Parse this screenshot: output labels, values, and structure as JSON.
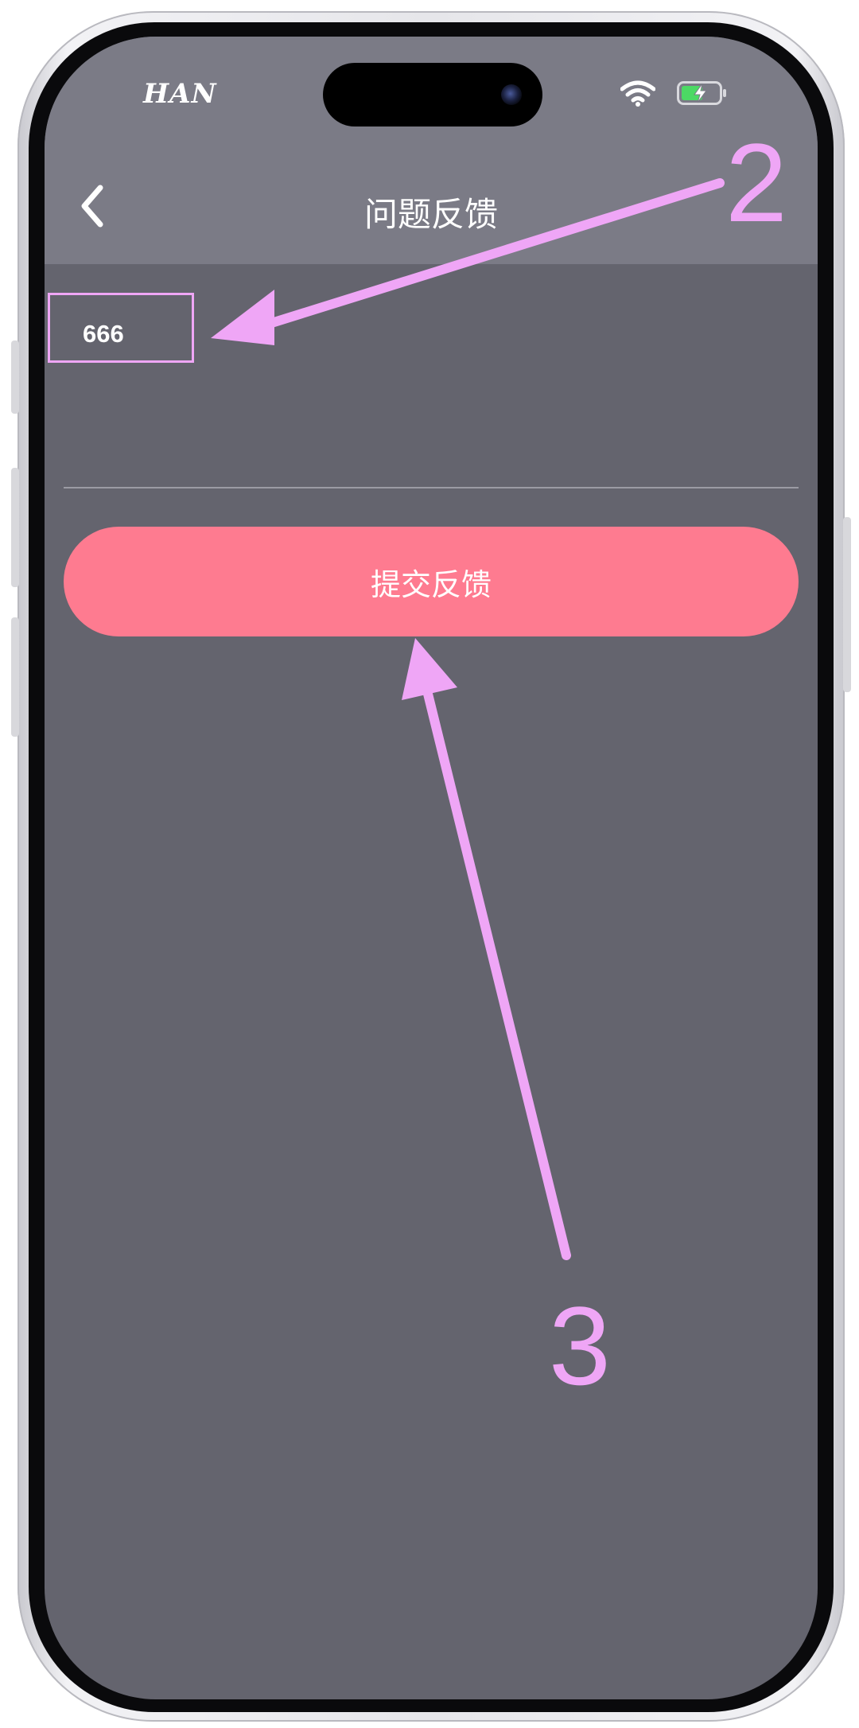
{
  "status_bar": {
    "carrier": "HAN"
  },
  "nav": {
    "title": "问题反馈",
    "back_icon": "chevron-left-icon"
  },
  "feedback": {
    "value": "666"
  },
  "submit_button": {
    "label": "提交反馈"
  },
  "annotations": {
    "label_input": "2",
    "label_button": "3"
  },
  "colors": {
    "accent_button": "#fe7b90",
    "annotation": "#efa6f6",
    "nav_bg": "#7b7b86",
    "screen_bg": "#64646e"
  }
}
